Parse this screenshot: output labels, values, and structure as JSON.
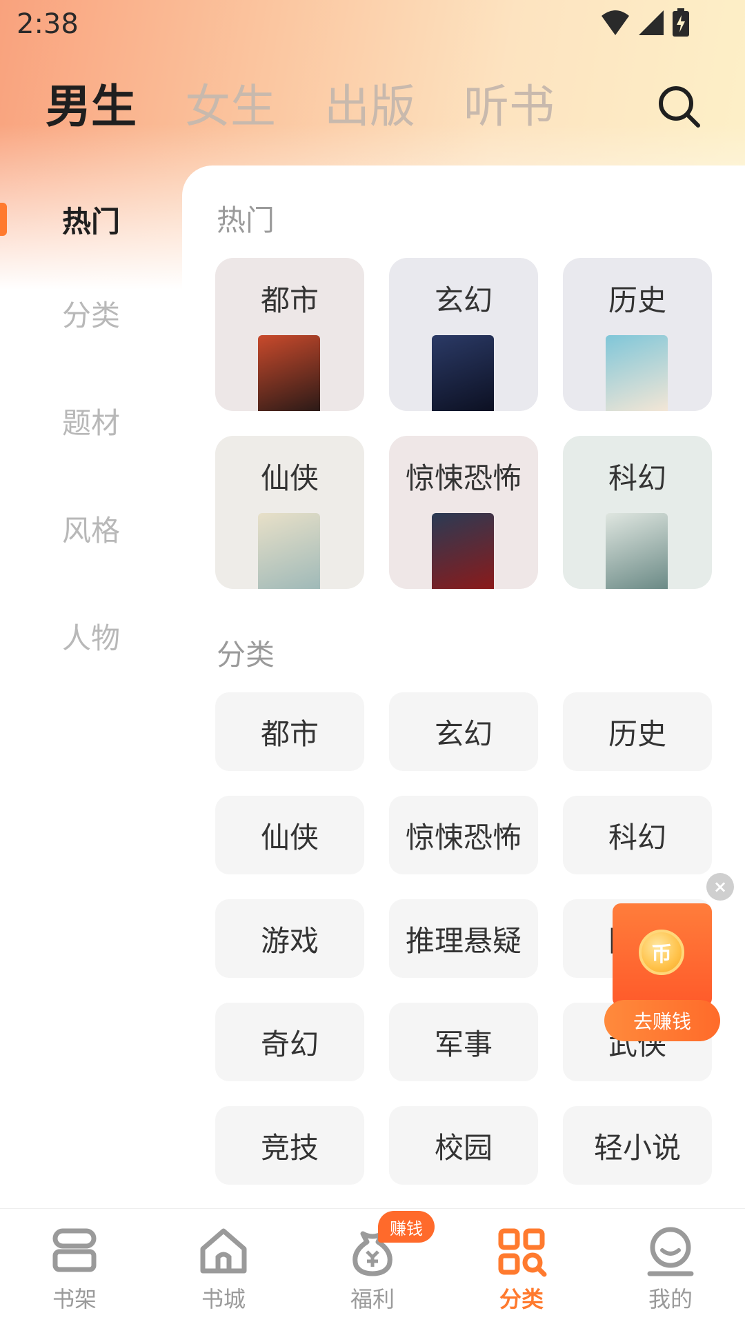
{
  "status_bar": {
    "time": "2:38"
  },
  "top_tabs": [
    {
      "label": "男生",
      "active": true
    },
    {
      "label": "女生",
      "active": false
    },
    {
      "label": "出版",
      "active": false
    },
    {
      "label": "听书",
      "active": false
    }
  ],
  "sidebar": {
    "items": [
      {
        "label": "热门",
        "active": true
      },
      {
        "label": "分类",
        "active": false
      },
      {
        "label": "题材",
        "active": false
      },
      {
        "label": "风格",
        "active": false
      },
      {
        "label": "人物",
        "active": false
      }
    ]
  },
  "hot_section": {
    "title": "热门",
    "cards": [
      {
        "label": "都市",
        "bg": "#ede7e7",
        "cover_colors": [
          "#c94a2c",
          "#2b1a17"
        ]
      },
      {
        "label": "玄幻",
        "bg": "#e9e9ee",
        "cover_colors": [
          "#2b3a66",
          "#0c1022"
        ]
      },
      {
        "label": "历史",
        "bg": "#e9e9ee",
        "cover_colors": [
          "#7fc6d8",
          "#f3e6d6"
        ]
      },
      {
        "label": "仙侠",
        "bg": "#eeece8",
        "cover_colors": [
          "#e8e0c8",
          "#9fb9b8"
        ]
      },
      {
        "label": "惊悚恐怖",
        "bg": "#efe7e7",
        "cover_colors": [
          "#2a3b55",
          "#8b1a1a"
        ]
      },
      {
        "label": "科幻",
        "bg": "#e6ece9",
        "cover_colors": [
          "#dfe6e0",
          "#6b8a86"
        ]
      }
    ]
  },
  "category_section": {
    "title": "分类",
    "chips": [
      "都市",
      "玄幻",
      "历史",
      "仙侠",
      "惊悚恐怖",
      "科幻",
      "游戏",
      "推理悬疑",
      "同人",
      "奇幻",
      "军事",
      "武侠",
      "竞技",
      "校园",
      "轻小说"
    ]
  },
  "earn_widget": {
    "coin_symbol": "币",
    "button_label": "去赚钱",
    "close_symbol": "×"
  },
  "bottom_nav": {
    "items": [
      {
        "label": "书架",
        "icon": "bookshelf-icon",
        "active": false
      },
      {
        "label": "书城",
        "icon": "home-icon",
        "active": false
      },
      {
        "label": "福利",
        "icon": "money-bag-icon",
        "active": false
      },
      {
        "label": "分类",
        "icon": "category-icon",
        "active": true
      },
      {
        "label": "我的",
        "icon": "profile-icon",
        "active": false
      }
    ],
    "badge": "赚钱"
  },
  "colors": {
    "accent": "#ff7a2e",
    "inactive": "#9a9a9a"
  }
}
